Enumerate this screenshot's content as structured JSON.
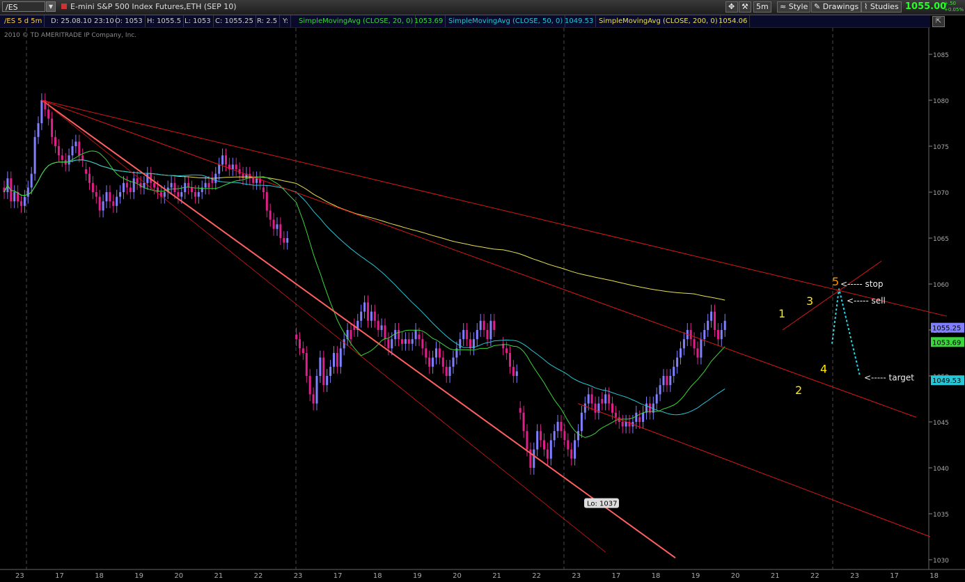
{
  "toolbar": {
    "symbol": "/ES",
    "instrument_title": "E-mini S&P 500 Index Futures,ETH (SEP 10)",
    "timeframe": "5m",
    "style_label": "Style",
    "drawings_label": "Drawings",
    "studies_label": "Studies",
    "last_price": "1055.00",
    "change": "+.50",
    "change_pct": "+0.05%"
  },
  "studybar": {
    "symbol_tf": "/ES 5 d 5m",
    "date": "D: 25.08.10 23:10",
    "open": "O: 1053",
    "high": "H: 1055.5",
    "low": "L: 1053",
    "close": "C: 1055.25",
    "range": "R: 2.5",
    "y": "Y:",
    "sma20_label": "SimpleMovingAvg (CLOSE, 20, 0)",
    "sma20_val": "1053.69",
    "sma50_label": "SimpleMovingAvg (CLOSE, 50, 0)",
    "sma50_val": "1049.53",
    "sma200_label": "SimpleMovingAvg (CLOSE, 200, 0)",
    "sma200_val": "1054.06"
  },
  "watermark": "2010 © TD AMERITRADE IP Company, Inc.",
  "colors": {
    "bull": "#8080ff",
    "bear": "#e0208a",
    "sma20": "#3bd63b",
    "sma50": "#26c6d6",
    "sma200": "#e8e050",
    "trend": "#d81818",
    "trend_light": "#ff6060",
    "label": "#ffe800",
    "label5": "#ff9000",
    "grid": "#4a4a4a"
  },
  "chart_data": {
    "type": "candlestick",
    "ylim": [
      1030,
      1088
    ],
    "y_ticks": [
      "1085",
      "1080",
      "1075",
      "1070",
      "1065",
      "1060",
      "1055",
      "1050",
      "1045",
      "1040",
      "1035",
      "1030"
    ],
    "x_ticks": [
      "23",
      "17",
      "18",
      "19",
      "20",
      "21",
      "22",
      "23",
      "17",
      "18",
      "19",
      "20",
      "21",
      "22",
      "23",
      "17",
      "18",
      "19",
      "20",
      "21",
      "22",
      "23",
      "17",
      "18",
      "19",
      "20",
      "21",
      "22",
      "23",
      "17",
      "18"
    ],
    "price_badges": [
      {
        "text": "1055.25",
        "value": 1055.25,
        "color": "#8080ff"
      },
      {
        "text": "1053.69",
        "value": 1053.69,
        "color": "#3bd63b"
      },
      {
        "text": "1049.53",
        "value": 1049.53,
        "color": "#26c6d6"
      }
    ],
    "low_label": {
      "text": "Lo: 1037",
      "value": 1037
    },
    "wave_labels": [
      "1",
      "2",
      "3",
      "4",
      "5"
    ],
    "annotations": [
      "<----- stop",
      "<----- sell",
      "<----- target"
    ],
    "sessions": [
      {
        "p": [
          1070,
          1071.5,
          1069,
          1070,
          1069,
          1068.5,
          1069.5,
          1070.5,
          1072,
          1076,
          1077.5,
          1080,
          1079,
          1078,
          1076,
          1075,
          1074,
          1073.5,
          1073,
          1074,
          1075,
          1075.5,
          1074,
          1073.5
        ]
      },
      {
        "p": [
          1072,
          1071,
          1070,
          1069.5,
          1068,
          1069,
          1070,
          1069,
          1068.5,
          1069.5,
          1070,
          1071,
          1070.5,
          1070,
          1071.5,
          1071,
          1070.5,
          1071,
          1072,
          1071
        ]
      },
      {
        "p": [
          1070.5,
          1070,
          1069.5,
          1070,
          1070.5,
          1071,
          1070,
          1069.5,
          1070,
          1071,
          1070.5,
          1070,
          1069.5,
          1070,
          1070.5,
          1071,
          1070.5
        ]
      },
      {
        "p": [
          1071,
          1072,
          1073,
          1074,
          1073,
          1072.5,
          1073,
          1072.5,
          1072,
          1071.5,
          1072,
          1071.5,
          1071,
          1071.5,
          1071
        ]
      },
      {
        "p": [
          1070,
          1068,
          1067,
          1066,
          1066.5,
          1065,
          1064.5,
          1065
        ]
      },
      {
        "p": [
          1054,
          1053,
          1052.5,
          1050,
          1048,
          1047,
          1050,
          1052,
          1049,
          1050,
          1051,
          1052.5,
          1051,
          1053,
          1054,
          1055,
          1054
        ]
      },
      {
        "p": [
          1055,
          1056,
          1057,
          1058,
          1056,
          1057,
          1056,
          1055,
          1055.5,
          1054,
          1053,
          1054,
          1055,
          1054,
          1053.5,
          1054,
          1053.5,
          1054,
          1055
        ]
      },
      {
        "p": [
          1054,
          1053,
          1052,
          1051,
          1052,
          1053,
          1052,
          1051,
          1050,
          1051,
          1052,
          1053,
          1054,
          1055,
          1054,
          1053,
          1054,
          1055,
          1056,
          1055,
          1054,
          1056,
          1055
        ]
      },
      {
        "p": [
          1053,
          1052.5,
          1051,
          1050,
          1050.5
        ]
      },
      {
        "p": [
          1046,
          1044,
          1042,
          1040,
          1042,
          1044,
          1043,
          1042,
          1041,
          1043,
          1044,
          1045,
          1044,
          1043,
          1042,
          1041,
          1043,
          1044,
          1046,
          1047,
          1048,
          1047,
          1046,
          1047
        ]
      },
      {
        "p": [
          1047,
          1048,
          1047,
          1046,
          1045.5,
          1045,
          1044.5,
          1045,
          1044.5,
          1045,
          1046
        ]
      },
      {
        "p": [
          1045,
          1046,
          1047,
          1046,
          1047,
          1048,
          1049,
          1050,
          1049,
          1050,
          1051,
          1052,
          1053,
          1054,
          1055,
          1054,
          1053,
          1052,
          1054,
          1055,
          1056,
          1057,
          1055,
          1054,
          1055,
          1056
        ]
      }
    ],
    "trend_lines": [
      {
        "name": "upper-trendline",
        "from": [
          1,
          1080
        ],
        "to": [
          2,
          1058
        ]
      },
      {
        "name": "lower-steep-trendline",
        "from": [
          1,
          1080
        ],
        "to": [
          3,
          1030
        ]
      }
    ]
  }
}
